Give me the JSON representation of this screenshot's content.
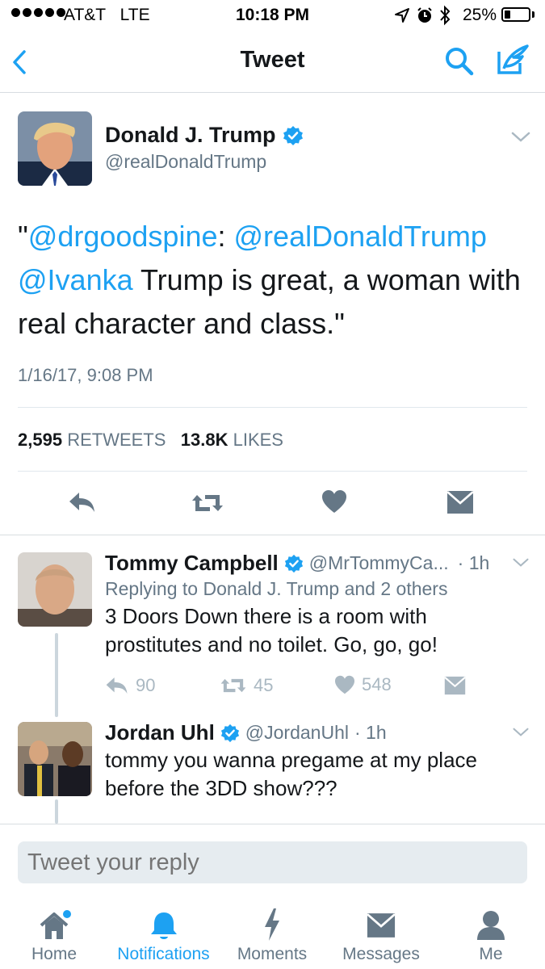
{
  "status_bar": {
    "carrier": "AT&T",
    "network": "LTE",
    "time": "10:18 PM",
    "battery": "25%",
    "battery_level": 0.25
  },
  "nav": {
    "title": "Tweet",
    "back_icon": "chevron-left-icon",
    "search_icon": "search-icon",
    "compose_icon": "compose-icon"
  },
  "tweet": {
    "author_name": "Donald J. Trump",
    "author_handle": "@realDonaldTrump",
    "text_parts": {
      "quote_open": "\"",
      "mention1": "@drgoodspine",
      "colon": ":",
      "mention2": "@realDonaldTrump",
      "mention3": "@Ivanka",
      "body1": " Trump is great, a woman with",
      "body2": "real character and class.\""
    },
    "timestamp": "1/16/17, 9:08 PM",
    "retweet_count": "2,595",
    "retweet_label": "RETWEETS",
    "like_count": "13.8K",
    "like_label": "LIKES"
  },
  "replies": [
    {
      "name": "Tommy Campbell",
      "handle": "@MrTommyCa...",
      "time": "· 1h",
      "replying_to": "Replying to Donald J. Trump and 2 others",
      "text_line1": "3 Doors Down there is a room with",
      "text_line2": "prostitutes and no toilet. Go, go, go!",
      "reply_count": "90",
      "retweet_count": "45",
      "like_count": "548"
    },
    {
      "name": "Jordan Uhl",
      "handle": "@JordanUhl",
      "time": "· 1h",
      "text_line1": "tommy you wanna pregame at my place",
      "text_line2": "before the 3DD show???"
    }
  ],
  "reply_box": {
    "placeholder": "Tweet your reply"
  },
  "tabs": [
    {
      "label": "Home",
      "icon": "home-icon"
    },
    {
      "label": "Notifications",
      "icon": "bell-icon"
    },
    {
      "label": "Moments",
      "icon": "lightning-icon"
    },
    {
      "label": "Messages",
      "icon": "envelope-icon"
    },
    {
      "label": "Me",
      "icon": "person-icon"
    }
  ],
  "colors": {
    "accent": "#1da1f2",
    "muted": "#657786",
    "light_icon": "#aab8c2",
    "action_icon": "#657786"
  }
}
